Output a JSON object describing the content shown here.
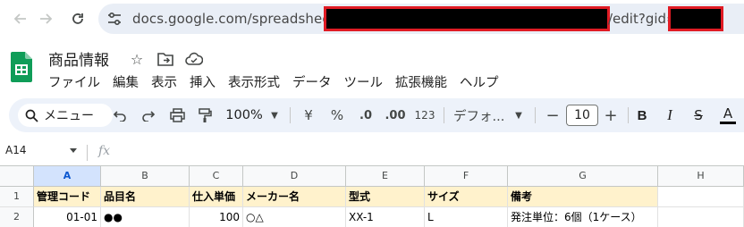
{
  "browser": {
    "url_prefix": "docs.google.com/spreadsheets/d/",
    "url_suffix": "/edit?gid="
  },
  "document": {
    "title": "商品情報"
  },
  "menu": [
    "ファイル",
    "編集",
    "表示",
    "挿入",
    "表示形式",
    "データ",
    "ツール",
    "拡張機能",
    "ヘルプ"
  ],
  "toolbar": {
    "menu_search_label": "メニュー",
    "zoom": "100%",
    "currency": "¥",
    "percent": "%",
    "decrease_decimal": ".0",
    "increase_decimal": ".00",
    "number_format": "123",
    "font": "デフォ...",
    "font_size": "10",
    "minus": "−",
    "plus": "+",
    "bold": "B",
    "italic": "I",
    "strike": "S",
    "text_color": "A"
  },
  "formula_bar": {
    "name_box": "A14",
    "fx": "fx"
  },
  "grid": {
    "columns": [
      "A",
      "B",
      "C",
      "D",
      "E",
      "F",
      "G",
      "H"
    ],
    "selected_column": "A",
    "rows": [
      {
        "num": "1",
        "cells": [
          "管理コード",
          "品目名",
          "仕入単価",
          "メーカー名",
          "型式",
          "サイズ",
          "備考",
          ""
        ]
      },
      {
        "num": "2",
        "cells": [
          "01-01",
          "●●",
          "100",
          "○△",
          "XX-1",
          "L",
          "発注単位：6個（1ケース）",
          ""
        ]
      }
    ]
  },
  "colors": {
    "header_fill": "#fff2cc",
    "selected_header": "#d3e3fd",
    "redaction_border": "#e01b24"
  }
}
